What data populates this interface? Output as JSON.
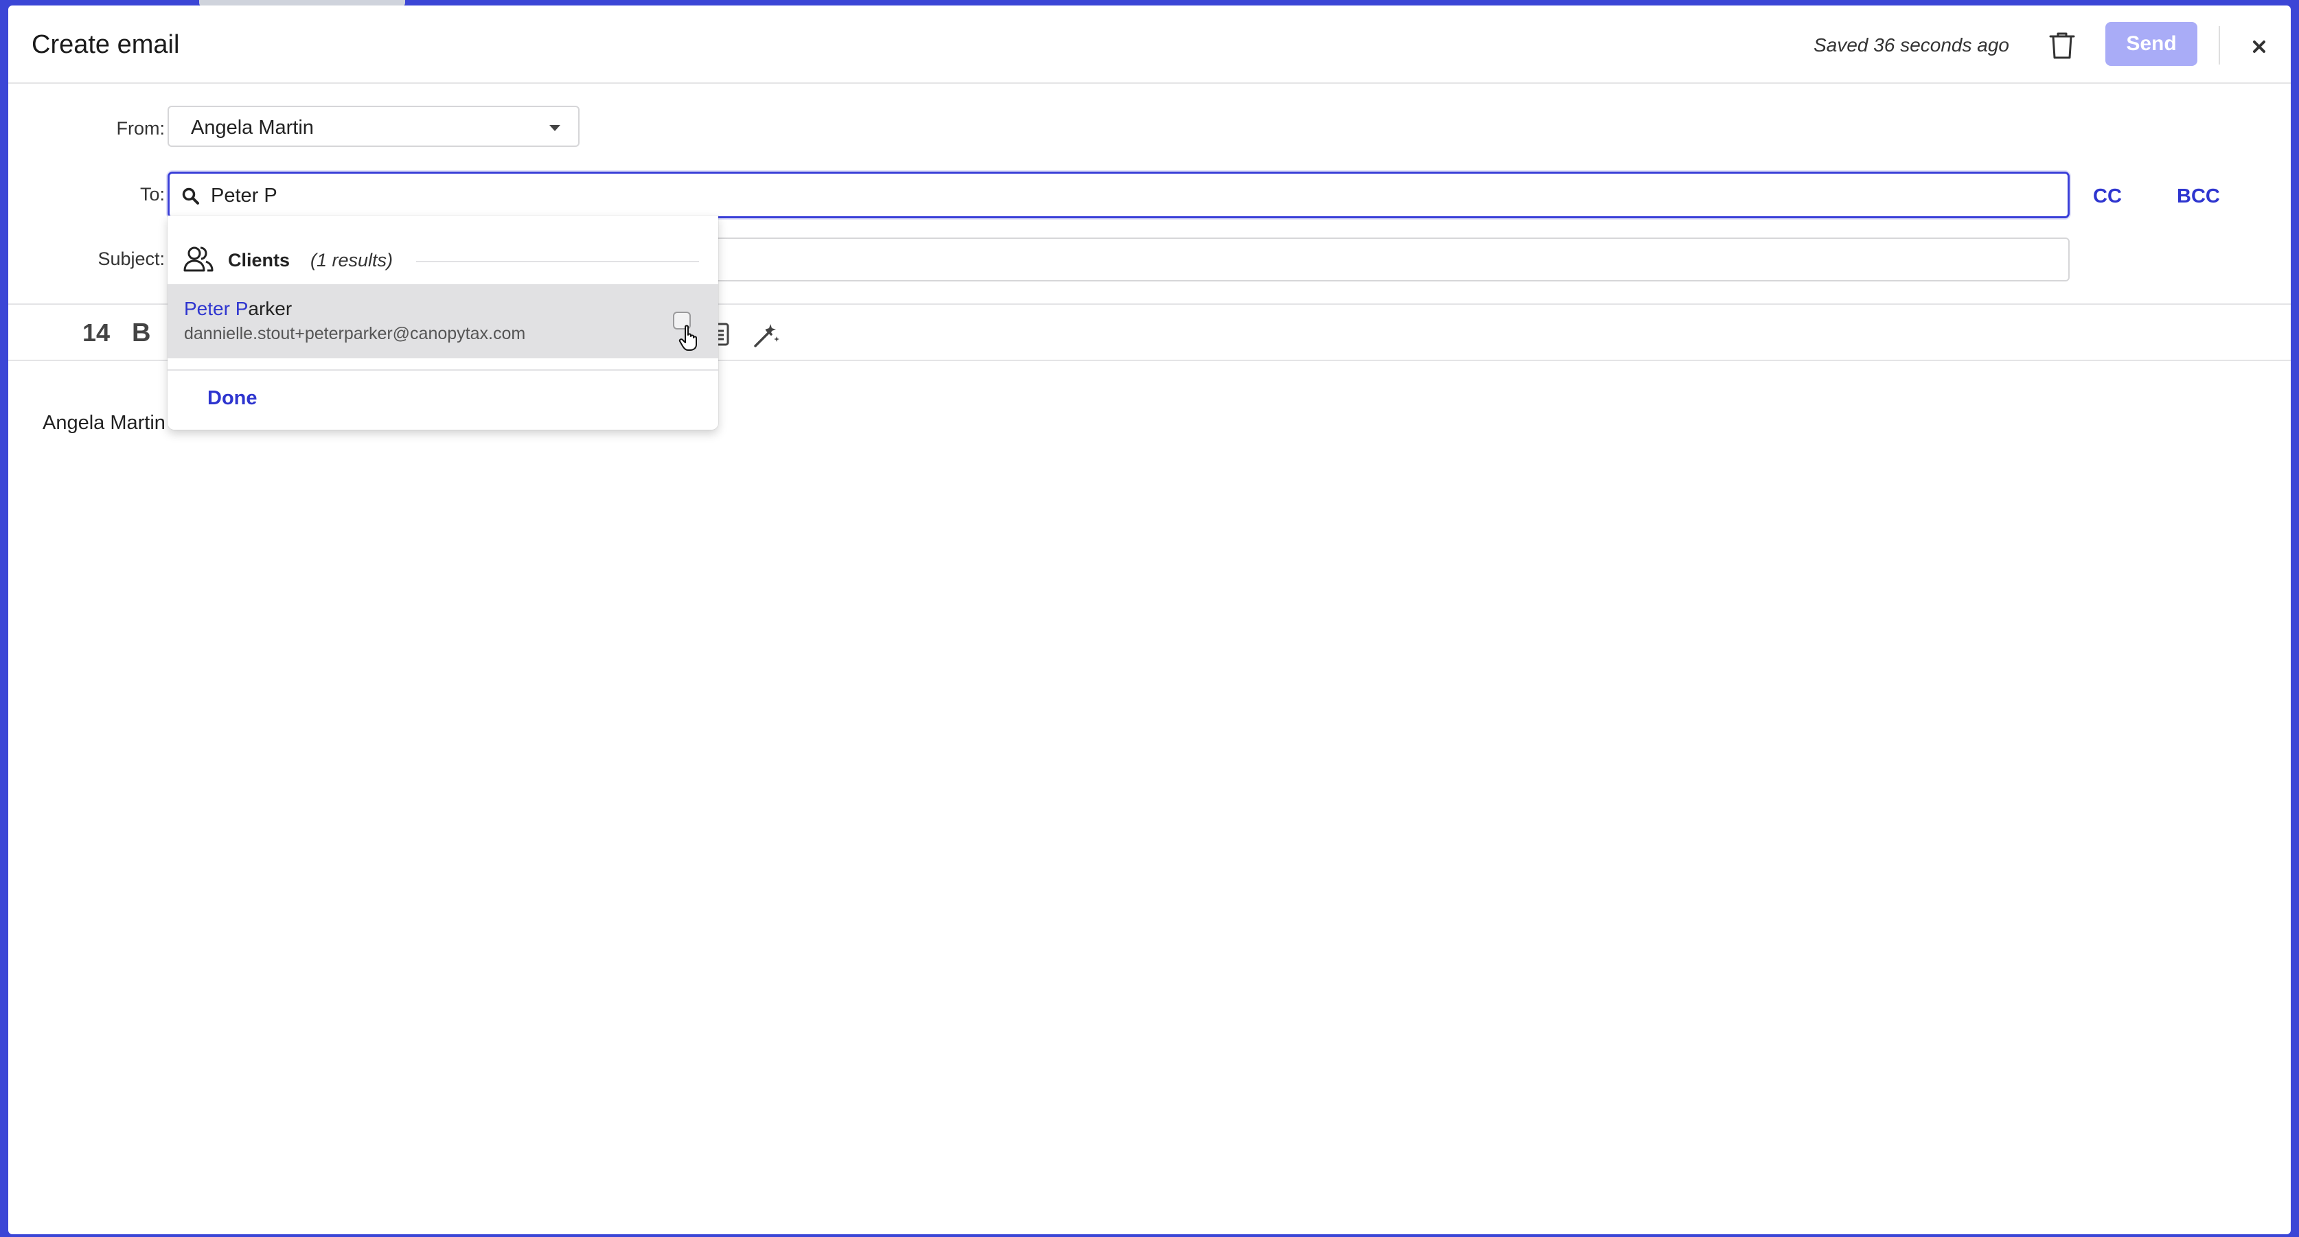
{
  "header": {
    "title": "Create email",
    "saved_status": "Saved 36 seconds ago",
    "send_label": "Send",
    "icons": [
      "trash-icon",
      "close-icon"
    ]
  },
  "form": {
    "from_label": "From:",
    "from_value": "Angela Martin",
    "to_label": "To:",
    "to_value": "Peter P",
    "cc_label": "CC",
    "bcc_label": "BCC",
    "subject_label": "Subject:",
    "subject_value": ""
  },
  "toolbar": {
    "font_size": "14",
    "bold_label": "B"
  },
  "editor": {
    "signature": "Angela Martin"
  },
  "dropdown": {
    "group_name": "Clients",
    "group_count": "(1 results)",
    "result": {
      "name_match": "Peter P",
      "name_rest": "arker",
      "email": "dannielle.stout+peterparker@canopytax.com",
      "checked": false
    },
    "done_label": "Done"
  },
  "colors": {
    "accent": "#2e35cf",
    "send_disabled": "#a9acf7",
    "hover_row": "#e1e1e3",
    "backdrop": "#3b46d6"
  }
}
